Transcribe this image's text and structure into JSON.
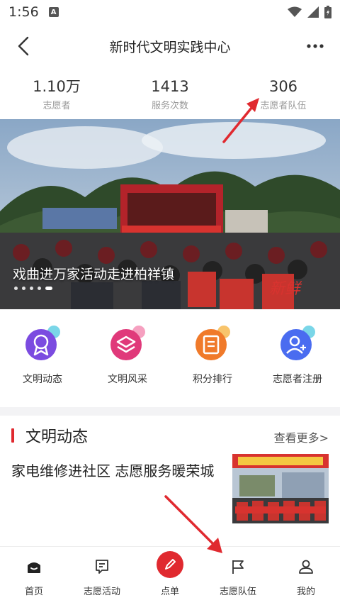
{
  "status_bar": {
    "time": "1:56",
    "notification_icon": "A",
    "icons": [
      "wifi-icon",
      "signal-icon",
      "battery-icon"
    ]
  },
  "header": {
    "title": "新时代文明实践中心",
    "back_icon": "chevron-left-icon",
    "more_icon": "more-dots-icon"
  },
  "stats": [
    {
      "value": "1.10万",
      "label": "志愿者"
    },
    {
      "value": "1413",
      "label": "服务次数"
    },
    {
      "value": "306",
      "label": "志愿者队伍"
    }
  ],
  "banner": {
    "caption": "戏曲进万家活动走进柏祥镇",
    "dot_count": 5,
    "active_dot": 4
  },
  "quick_menu": [
    {
      "label": "文明动态",
      "icon": "award-icon",
      "color": "#7b4be0"
    },
    {
      "label": "文明风采",
      "icon": "layers-icon",
      "color": "#e0397a"
    },
    {
      "label": "积分排行",
      "icon": "document-icon",
      "color": "#f07a2a"
    },
    {
      "label": "志愿者注册",
      "icon": "add-user-icon",
      "color": "#4a6cf0"
    }
  ],
  "section": {
    "title": "文明动态",
    "see_more": "查看更多>",
    "accent_color": "#e0292f"
  },
  "news": [
    {
      "title": "家电维修进社区 志愿服务暖荣城"
    }
  ],
  "bottom_nav": [
    {
      "label": "首页",
      "icon": "home-icon"
    },
    {
      "label": "志愿活动",
      "icon": "message-square-icon"
    },
    {
      "label": "点单",
      "icon": "pen-icon"
    },
    {
      "label": "志愿队伍",
      "icon": "flag-icon"
    },
    {
      "label": "我的",
      "icon": "user-icon"
    }
  ]
}
